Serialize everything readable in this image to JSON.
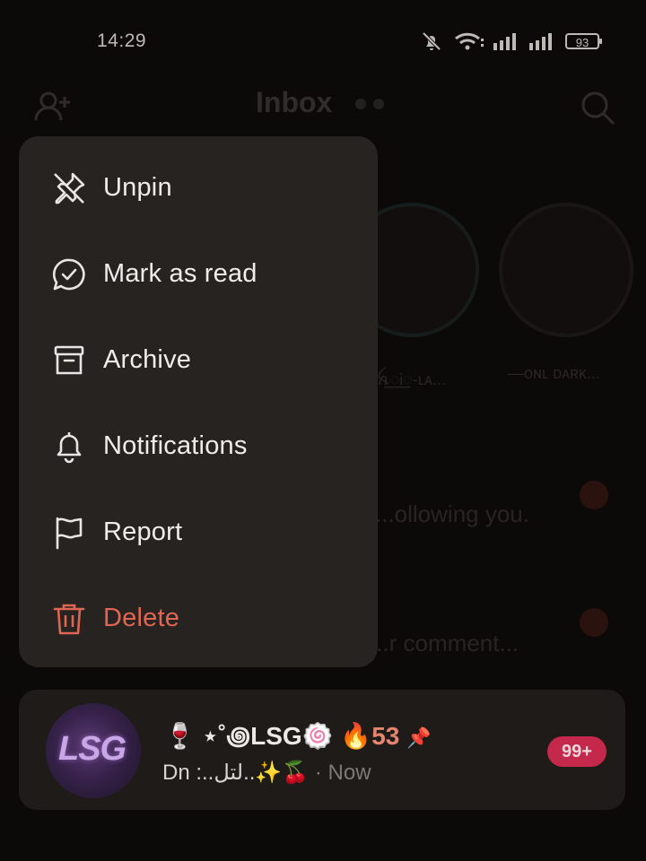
{
  "status_bar": {
    "time": "14:29",
    "battery": "93",
    "icons": [
      "mute-bell-icon",
      "wifi-icon",
      "signal-icon",
      "signal-icon",
      "battery-icon"
    ]
  },
  "background": {
    "title": "Inbox",
    "story_names": [
      "ꫝ꯭Ꭵ꯭-ʟᴀ...",
      "—ᴏɴʟ ᴅᴀʀᴋ..."
    ],
    "lines": [
      "...ollowing you.",
      "...r comment..."
    ]
  },
  "menu": {
    "items": [
      {
        "label": "Unpin",
        "icon": "unpin-icon"
      },
      {
        "label": "Mark as read",
        "icon": "mark-read-icon"
      },
      {
        "label": "Archive",
        "icon": "archive-icon"
      },
      {
        "label": "Notifications",
        "icon": "bell-icon"
      },
      {
        "label": "Report",
        "icon": "flag-icon"
      },
      {
        "label": "Delete",
        "icon": "trash-icon"
      }
    ],
    "danger_color": "#e06552"
  },
  "chat": {
    "name_prefix": "🍷 ⋆˚꩜LSG",
    "name_suffix": "🍥",
    "streak_fire": "🔥",
    "streak_count": "53",
    "pin_glyph": "📌",
    "preview_text": "Dn :..لتل..✨🍒",
    "preview_sep": " · ",
    "timestamp": "Now",
    "unread": "99+",
    "avatar_text": "LSG",
    "badge_color": "#c4284a"
  }
}
